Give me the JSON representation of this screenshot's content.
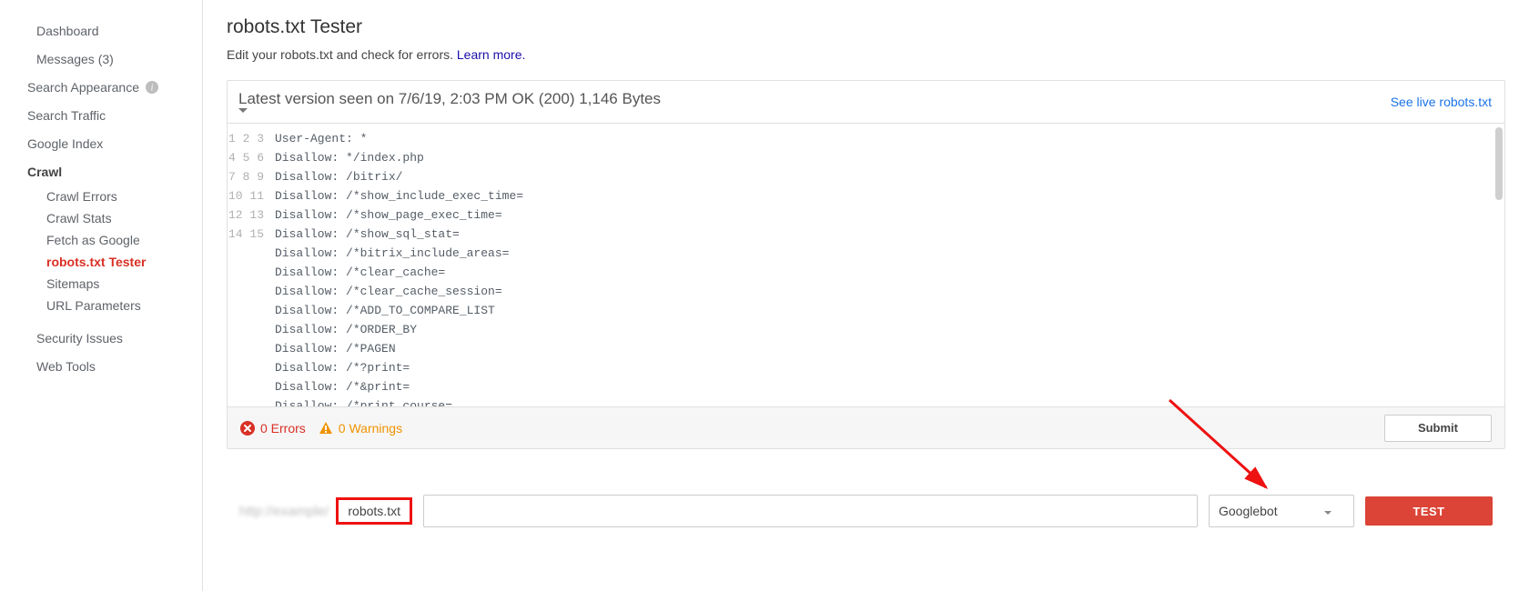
{
  "sidebar": {
    "items": [
      {
        "label": "Dashboard",
        "type": "plain"
      },
      {
        "label": "Messages (3)",
        "type": "plain"
      },
      {
        "label": "Search Appearance",
        "type": "caret",
        "info": true
      },
      {
        "label": "Search Traffic",
        "type": "caret"
      },
      {
        "label": "Google Index",
        "type": "caret"
      },
      {
        "label": "Crawl",
        "type": "caret-open"
      },
      {
        "label": "Security Issues",
        "type": "plain-gap"
      },
      {
        "label": "Web Tools",
        "type": "plain"
      }
    ],
    "crawl_sub": [
      {
        "label": "Crawl Errors"
      },
      {
        "label": "Crawl Stats"
      },
      {
        "label": "Fetch as Google"
      },
      {
        "label": "robots.txt Tester",
        "active": true
      },
      {
        "label": "Sitemaps"
      },
      {
        "label": "URL Parameters"
      }
    ]
  },
  "page": {
    "title": "robots.txt Tester",
    "subtitle_prefix": "Edit your robots.txt and check for errors. ",
    "learn_more": "Learn more.",
    "version_text": "Latest version seen on 7/6/19, 2:03 PM OK (200) 1,146 Bytes",
    "live_link": "See live robots.txt"
  },
  "editor": {
    "lines": [
      "User-Agent: *",
      "Disallow: */index.php",
      "Disallow: /bitrix/",
      "Disallow: /*show_include_exec_time=",
      "Disallow: /*show_page_exec_time=",
      "Disallow: /*show_sql_stat=",
      "Disallow: /*bitrix_include_areas=",
      "Disallow: /*clear_cache=",
      "Disallow: /*clear_cache_session=",
      "Disallow: /*ADD_TO_COMPARE_LIST",
      "Disallow: /*ORDER_BY",
      "Disallow: /*PAGEN",
      "Disallow: /*?print=",
      "Disallow: /*&print=",
      "Disallow: /*print_course="
    ]
  },
  "status": {
    "errors": "0 Errors",
    "warnings": "0 Warnings",
    "submit": "Submit"
  },
  "test": {
    "blurred_prefix": "http://example/",
    "chip": "robots.txt",
    "url_value": "",
    "agent": "Googlebot",
    "button": "TEST"
  }
}
